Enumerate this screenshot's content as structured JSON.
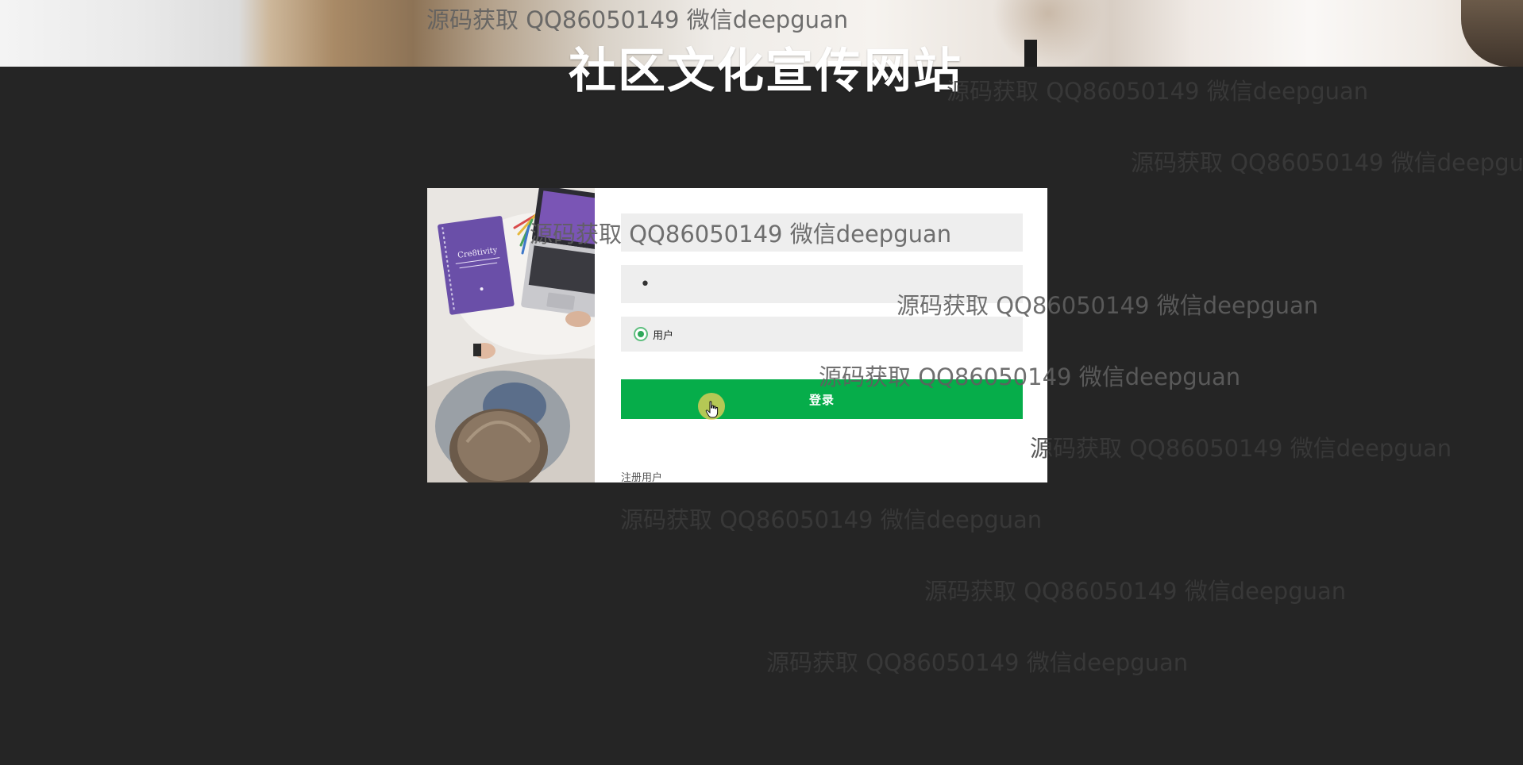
{
  "site": {
    "title": "社区文化宣传网站"
  },
  "login": {
    "username_value": "",
    "password_value": "•",
    "role_option_label": "用户",
    "submit_label": "登录",
    "register_link_label": "注册用户"
  },
  "watermark_text": "源码获取 QQ86050149 微信deepguan",
  "colors": {
    "background": "#252525",
    "card": "#ffffff",
    "field": "#eeeeee",
    "primary_button": "#06ad4a",
    "radio_accent": "#2fa85a"
  }
}
